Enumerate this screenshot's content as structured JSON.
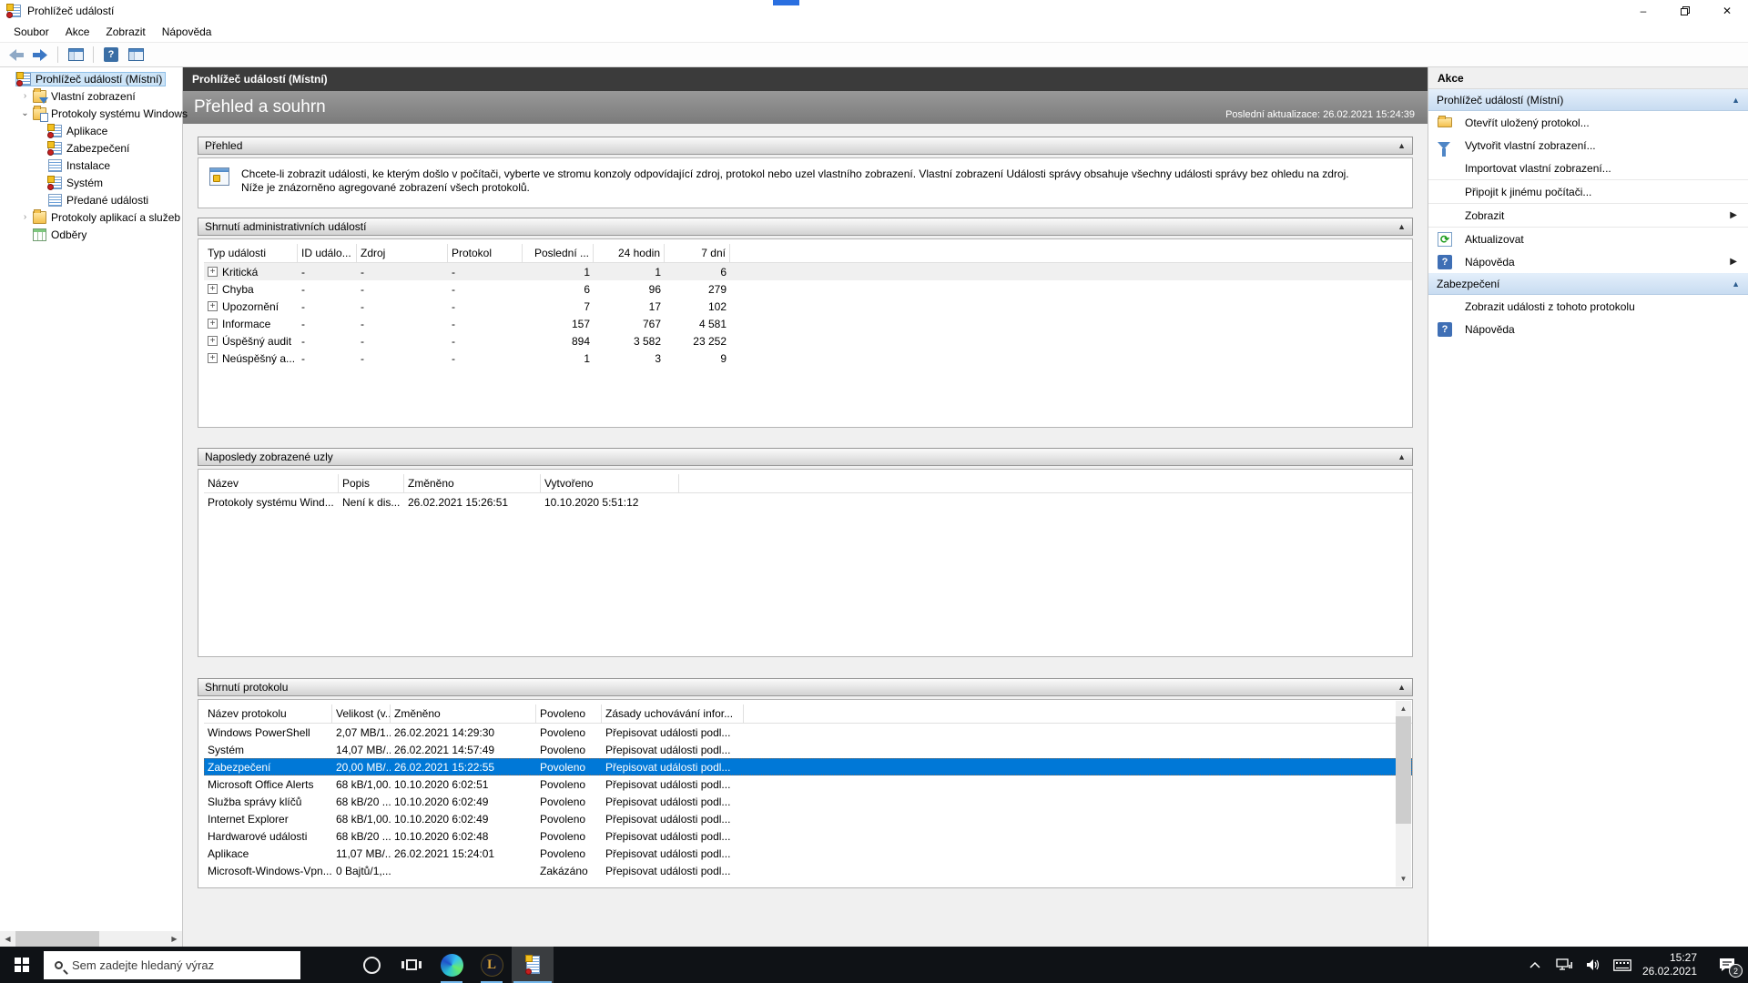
{
  "window": {
    "title": "Prohlížeč událostí"
  },
  "menu": [
    "Soubor",
    "Akce",
    "Zobrazit",
    "Nápověda"
  ],
  "tree": {
    "items": [
      {
        "label": "Prohlížeč událostí (Místní)",
        "level": 0,
        "icon": "event-viewer",
        "expander": null,
        "selected": true
      },
      {
        "label": "Vlastní zobrazení",
        "level": 1,
        "icon": "folder-filter",
        "expander": "collapsed",
        "selected": false
      },
      {
        "label": "Protokoly systému Windows",
        "level": 1,
        "icon": "folder-log",
        "expander": "expanded",
        "selected": false
      },
      {
        "label": "Aplikace",
        "level": 2,
        "icon": "log-alert",
        "expander": null,
        "selected": false
      },
      {
        "label": "Zabezpečení",
        "level": 2,
        "icon": "log-alert",
        "expander": null,
        "selected": false
      },
      {
        "label": "Instalace",
        "level": 2,
        "icon": "log",
        "expander": null,
        "selected": false
      },
      {
        "label": "Systém",
        "level": 2,
        "icon": "log-alert",
        "expander": null,
        "selected": false
      },
      {
        "label": "Předané události",
        "level": 2,
        "icon": "log",
        "expander": null,
        "selected": false
      },
      {
        "label": "Protokoly aplikací a služeb",
        "level": 1,
        "icon": "folder",
        "expander": "collapsed",
        "selected": false
      },
      {
        "label": "Odběry",
        "level": 1,
        "icon": "subscriptions",
        "expander": null,
        "selected": false
      }
    ]
  },
  "content": {
    "crumb": "Prohlížeč událostí (Místní)",
    "title": "Přehled a souhrn",
    "last_update": "Poslední aktualizace: 26.02.2021 15:24:39",
    "overview": {
      "title": "Přehled",
      "text": "Chcete-li zobrazit události, ke kterým došlo v počítači, vyberte ve stromu konzoly odpovídající zdroj, protokol nebo uzel vlastního zobrazení. Vlastní zobrazení Události správy obsahuje všechny události správy bez ohledu na zdroj. Níže je znázorněno agregované zobrazení všech protokolů."
    },
    "admin_summary": {
      "title": "Shrnutí administrativních událostí",
      "columns": [
        "Typ události",
        "ID událo...",
        "Zdroj",
        "Protokol",
        "Poslední ...",
        "24 hodin",
        "7 dní"
      ],
      "rows": [
        [
          "Kritická",
          "-",
          "-",
          "-",
          "1",
          "1",
          "6"
        ],
        [
          "Chyba",
          "-",
          "-",
          "-",
          "6",
          "96",
          "279"
        ],
        [
          "Upozornění",
          "-",
          "-",
          "-",
          "7",
          "17",
          "102"
        ],
        [
          "Informace",
          "-",
          "-",
          "-",
          "157",
          "767",
          "4 581"
        ],
        [
          "Úspěšný audit",
          "-",
          "-",
          "-",
          "894",
          "3 582",
          "23 252"
        ],
        [
          "Neúspěšný a...",
          "-",
          "-",
          "-",
          "1",
          "3",
          "9"
        ]
      ]
    },
    "recent_nodes": {
      "title": "Naposledy zobrazené uzly",
      "columns": [
        "Název",
        "Popis",
        "Změněno",
        "Vytvořeno"
      ],
      "rows": [
        [
          "Protokoly systému Wind...",
          "Není k dis...",
          "26.02.2021 15:26:51",
          "10.10.2020 5:51:12"
        ]
      ]
    },
    "log_summary": {
      "title": "Shrnutí protokolu",
      "columns": [
        "Název protokolu",
        "Velikost (v...",
        "Změněno",
        "Povoleno",
        "Zásady uchovávání infor..."
      ],
      "selected_row": 2,
      "rows": [
        [
          "Windows PowerShell",
          "2,07 MB/1...",
          "26.02.2021 14:29:30",
          "Povoleno",
          "Přepisovat události podl..."
        ],
        [
          "Systém",
          "14,07 MB/...",
          "26.02.2021 14:57:49",
          "Povoleno",
          "Přepisovat události podl..."
        ],
        [
          "Zabezpečení",
          "20,00 MB/...",
          "26.02.2021 15:22:55",
          "Povoleno",
          "Přepisovat události podl..."
        ],
        [
          "Microsoft Office Alerts",
          "68 kB/1,00...",
          "10.10.2020 6:02:51",
          "Povoleno",
          "Přepisovat události podl..."
        ],
        [
          "Služba správy klíčů",
          "68 kB/20 ...",
          "10.10.2020 6:02:49",
          "Povoleno",
          "Přepisovat události podl..."
        ],
        [
          "Internet Explorer",
          "68 kB/1,00...",
          "10.10.2020 6:02:49",
          "Povoleno",
          "Přepisovat události podl..."
        ],
        [
          "Hardwarové události",
          "68 kB/20 ...",
          "10.10.2020 6:02:48",
          "Povoleno",
          "Přepisovat události podl..."
        ],
        [
          "Aplikace",
          "11,07 MB/...",
          "26.02.2021 15:24:01",
          "Povoleno",
          "Přepisovat události podl..."
        ],
        [
          "Microsoft-Windows-Vpn...",
          "0 Bajtů/1,...",
          "",
          "Zakázáno",
          "Přepisovat události podl..."
        ]
      ]
    }
  },
  "actions": {
    "title": "Akce",
    "sections": [
      {
        "title": "Prohlížeč událostí (Místní)",
        "items": [
          {
            "label": "Otevřít uložený protokol...",
            "icon": "open-folder",
            "arrow": false,
            "sep_before": false
          },
          {
            "label": "Vytvořit vlastní zobrazení...",
            "icon": "filter",
            "arrow": false,
            "sep_before": false
          },
          {
            "label": "Importovat vlastní zobrazení...",
            "icon": null,
            "arrow": false,
            "sep_before": false
          },
          {
            "label": "Připojit k jinému počítači...",
            "icon": null,
            "arrow": false,
            "sep_before": true
          },
          {
            "label": "Zobrazit",
            "icon": null,
            "arrow": true,
            "sep_before": true
          },
          {
            "label": "Aktualizovat",
            "icon": "refresh",
            "arrow": false,
            "sep_before": true
          },
          {
            "label": "Nápověda",
            "icon": "help",
            "arrow": true,
            "sep_before": false
          }
        ]
      },
      {
        "title": "Zabezpečení",
        "items": [
          {
            "label": "Zobrazit události z tohoto protokolu",
            "icon": null,
            "arrow": false,
            "sep_before": false
          },
          {
            "label": "Nápověda",
            "icon": "help",
            "arrow": false,
            "sep_before": false
          }
        ]
      }
    ]
  },
  "taskbar": {
    "search_placeholder": "Sem zadejte hledaný výraz",
    "time": "15:27",
    "date": "26.02.2021",
    "notification_badge": "2"
  }
}
